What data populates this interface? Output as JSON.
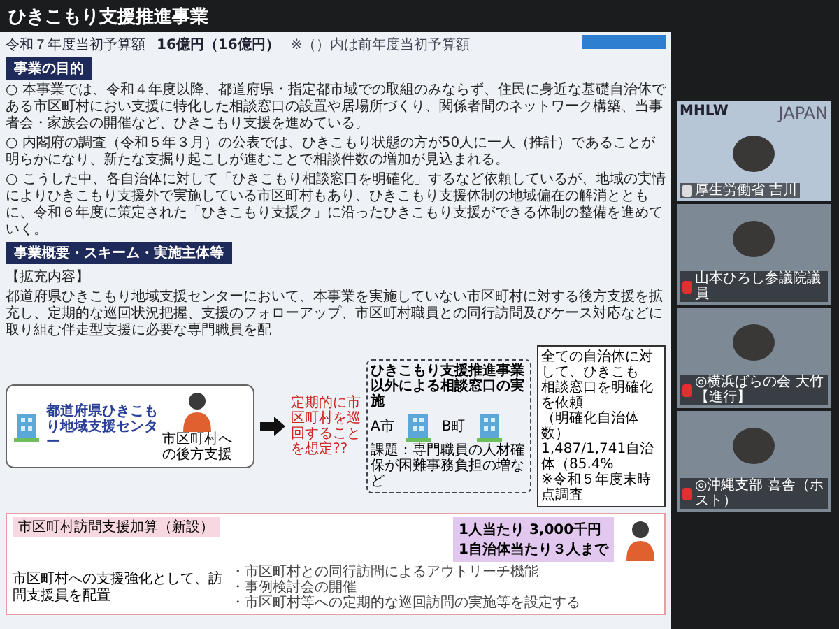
{
  "slide": {
    "title": "ひきこもり支援推進事業",
    "budget": {
      "label": "令和７年度当初予算額",
      "amount": "16億円（16億円）",
      "note": "※（）内は前年度当初予算額"
    },
    "purpose": {
      "heading": "事業の目的",
      "paragraphs": [
        "○ 本事業では、令和４年度以降、都道府県・指定都市域での取組のみならず、住民に身近な基礎自治体である市区町村におい支援に特化した相談窓口の設置や居場所づくり、関係者間のネットワーク構築、当事者会・家族会の開催など、ひきこもり支援を進めている。",
        "○ 内閣府の調査（令和５年３月）の公表では、ひきこもり状態の方が50人に一人（推計）であることが明らかになり、新たな支掘り起こしが進むことで相談件数の増加が見込まれる。",
        "○ こうした中、各自治体に対して「ひきこもり相談窓口を明確化」するなど依頼しているが、地域の実情によりひきこもり支援外で実施している市区町村もあり、ひきこもり支援体制の地域偏在の解消とともに、令和６年度に策定された「ひきこもり支援ク」に沿ったひきこもり支援ができる体制の整備を進めていく。"
      ]
    },
    "overview": {
      "heading": "事業概要・スキーム・実施主体等",
      "subheading": "【拡充内容】",
      "paragraphs": [
        "都道府県ひきこもり地域支援センターにおいて、本事業を実施していない市区町村に対する後方支援を拡充し、定期的な巡回状況把握、支援のフォローアップ、市区町村職員との同行訪問及びケース対応などに取り組む伴走型支援に必要な専門職員を配"
      ]
    },
    "center_box": {
      "name": "都道府県ひきこもり地域支援センター",
      "staff_caption": "市区町村への後方支援"
    },
    "arrow_note": "定期的に市区町村を巡回することを想定??",
    "other_box": {
      "title": "ひきこもり支援推進事業以外による相談窓口の実施",
      "towns": [
        "A市",
        "B町"
      ],
      "issue": "課題：専門職員の人材確保が困難事務負担の増など"
    },
    "stats_box": {
      "lines": [
        "全ての自治体に対して、ひきこも",
        "相談窓口を明確化を依頼",
        "（明確化自治体数）",
        "1,487/1,741自治体（85.4%",
        "※令和５年度末時点調査"
      ]
    },
    "addition": {
      "tag": "市区町村訪問支援加算（新設）",
      "summary": "市区町村への支援強化として、訪問支援員を配置",
      "bullets": [
        "・市区町村との同行訪問によるアウトリーチ機能",
        "・事例検討会の開催",
        "・市区町村等への定期的な巡回訪問の実施等を設定する"
      ],
      "amounts": [
        "1人当たり 3,000千円",
        "1自治体当たり３人まで"
      ]
    }
  },
  "video": {
    "logo": "MHLW",
    "country": "JAPAN",
    "participants": [
      {
        "name": "厚生労働省 吉川",
        "muted": false
      },
      {
        "name": "山本ひろし参議院議員",
        "muted": true
      },
      {
        "name": "◎横浜ばらの会 大竹【進行】",
        "muted": true
      },
      {
        "name": "◎沖縄支部 喜舎（ホスト）",
        "muted": true
      }
    ]
  }
}
